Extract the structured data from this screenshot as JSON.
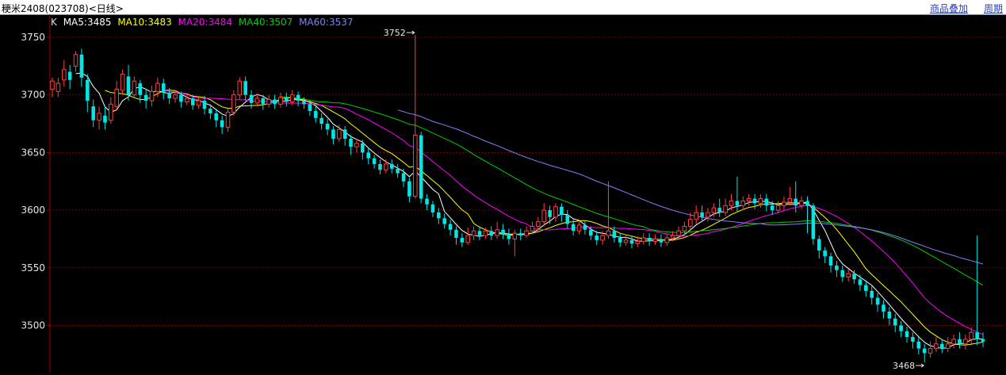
{
  "header": {
    "title": "粳米2408(023708)<日线>",
    "overlay_link": "商品叠加",
    "period_link": "周期"
  },
  "indicator": {
    "label": "K",
    "ma5": "MA5:3485",
    "ma10": "MA10:3483",
    "ma20": "MA20:3484",
    "ma40": "MA40:3507",
    "ma60": "MA60:3537"
  },
  "colors": {
    "background": "#000000",
    "up": "#ff4040",
    "down": "#00e5e5",
    "ma5": "#ffffff",
    "ma10": "#ffff00",
    "ma20": "#ff00ff",
    "ma40": "#00d000",
    "ma60": "#8080ff",
    "grid": "#800000"
  },
  "chart_data": {
    "type": "candlestick",
    "yticks": [
      3750,
      3700,
      3650,
      3600,
      3550,
      3500
    ],
    "ylim": [
      3463,
      3768
    ],
    "annotations": {
      "high": "3752",
      "low": "3468"
    },
    "candles": [
      [
        3705,
        3712,
        3698,
        3715
      ],
      [
        3703,
        3710,
        3698,
        3715
      ],
      [
        3713,
        3722,
        3707,
        3730
      ],
      [
        3720,
        3713,
        3705,
        3726
      ],
      [
        3725,
        3735,
        3720,
        3738
      ],
      [
        3735,
        3715,
        3707,
        3740
      ],
      [
        3713,
        3695,
        3685,
        3718
      ],
      [
        3690,
        3678,
        3672,
        3696
      ],
      [
        3678,
        3684,
        3670,
        3690
      ],
      [
        3682,
        3676,
        3670,
        3690
      ],
      [
        3678,
        3692,
        3675,
        3698
      ],
      [
        3690,
        3705,
        3687,
        3712
      ],
      [
        3704,
        3718,
        3700,
        3722
      ],
      [
        3716,
        3700,
        3695,
        3726
      ],
      [
        3700,
        3712,
        3697,
        3716
      ],
      [
        3710,
        3700,
        3693,
        3713
      ],
      [
        3700,
        3695,
        3688,
        3705
      ],
      [
        3695,
        3703,
        3690,
        3708
      ],
      [
        3703,
        3710,
        3698,
        3715
      ],
      [
        3710,
        3702,
        3696,
        3714
      ],
      [
        3702,
        3697,
        3692,
        3706
      ],
      [
        3697,
        3700,
        3693,
        3704
      ],
      [
        3700,
        3694,
        3689,
        3703
      ],
      [
        3694,
        3697,
        3691,
        3700
      ],
      [
        3697,
        3691,
        3687,
        3700
      ],
      [
        3691,
        3695,
        3688,
        3698
      ],
      [
        3695,
        3688,
        3683,
        3699
      ],
      [
        3688,
        3684,
        3679,
        3692
      ],
      [
        3684,
        3678,
        3672,
        3688
      ],
      [
        3678,
        3672,
        3666,
        3682
      ],
      [
        3672,
        3685,
        3668,
        3689
      ],
      [
        3685,
        3700,
        3682,
        3704
      ],
      [
        3700,
        3712,
        3696,
        3715
      ],
      [
        3712,
        3700,
        3695,
        3716
      ],
      [
        3700,
        3693,
        3688,
        3704
      ],
      [
        3693,
        3697,
        3690,
        3701
      ],
      [
        3697,
        3692,
        3687,
        3700
      ],
      [
        3692,
        3696,
        3689,
        3700
      ],
      [
        3696,
        3692,
        3688,
        3700
      ],
      [
        3692,
        3698,
        3689,
        3702
      ],
      [
        3698,
        3694,
        3690,
        3702
      ],
      [
        3694,
        3700,
        3691,
        3704
      ],
      [
        3700,
        3695,
        3690,
        3703
      ],
      [
        3695,
        3692,
        3688,
        3698
      ],
      [
        3692,
        3686,
        3682,
        3695
      ],
      [
        3686,
        3680,
        3676,
        3690
      ],
      [
        3680,
        3675,
        3670,
        3684
      ],
      [
        3675,
        3670,
        3665,
        3679
      ],
      [
        3670,
        3662,
        3657,
        3673
      ],
      [
        3662,
        3670,
        3659,
        3674
      ],
      [
        3670,
        3662,
        3656,
        3673
      ],
      [
        3662,
        3655,
        3648,
        3665
      ],
      [
        3655,
        3658,
        3650,
        3662
      ],
      [
        3658,
        3650,
        3644,
        3661
      ],
      [
        3650,
        3645,
        3640,
        3654
      ],
      [
        3645,
        3640,
        3636,
        3648
      ],
      [
        3640,
        3635,
        3631,
        3644
      ],
      [
        3635,
        3640,
        3632,
        3644
      ],
      [
        3640,
        3636,
        3632,
        3644
      ],
      [
        3636,
        3632,
        3628,
        3640
      ],
      [
        3632,
        3625,
        3620,
        3636
      ],
      [
        3625,
        3612,
        3607,
        3628
      ],
      [
        3612,
        3665,
        3610,
        3752
      ],
      [
        3665,
        3610,
        3606,
        3668
      ],
      [
        3610,
        3605,
        3600,
        3614
      ],
      [
        3605,
        3598,
        3594,
        3608
      ],
      [
        3598,
        3593,
        3588,
        3602
      ],
      [
        3593,
        3588,
        3584,
        3597
      ],
      [
        3588,
        3583,
        3578,
        3592
      ],
      [
        3583,
        3576,
        3570,
        3586
      ],
      [
        3576,
        3572,
        3568,
        3580
      ],
      [
        3572,
        3578,
        3570,
        3585
      ],
      [
        3578,
        3582,
        3574,
        3586
      ],
      [
        3582,
        3578,
        3574,
        3586
      ],
      [
        3578,
        3582,
        3575,
        3585
      ],
      [
        3582,
        3578,
        3574,
        3586
      ],
      [
        3578,
        3583,
        3575,
        3590
      ],
      [
        3583,
        3579,
        3575,
        3588
      ],
      [
        3579,
        3575,
        3570,
        3584
      ],
      [
        3575,
        3580,
        3560,
        3583
      ],
      [
        3580,
        3578,
        3574,
        3584
      ],
      [
        3578,
        3582,
        3576,
        3586
      ],
      [
        3582,
        3586,
        3579,
        3590
      ],
      [
        3586,
        3590,
        3582,
        3594
      ],
      [
        3590,
        3600,
        3586,
        3606
      ],
      [
        3600,
        3594,
        3588,
        3604
      ],
      [
        3594,
        3603,
        3590,
        3606
      ],
      [
        3603,
        3596,
        3590,
        3606
      ],
      [
        3596,
        3588,
        3584,
        3600
      ],
      [
        3588,
        3582,
        3578,
        3592
      ],
      [
        3582,
        3587,
        3579,
        3590
      ],
      [
        3587,
        3583,
        3579,
        3591
      ],
      [
        3583,
        3578,
        3574,
        3586
      ],
      [
        3578,
        3574,
        3570,
        3582
      ],
      [
        3574,
        3578,
        3570,
        3582
      ],
      [
        3578,
        3582,
        3575,
        3625
      ],
      [
        3582,
        3576,
        3572,
        3586
      ],
      [
        3576,
        3572,
        3568,
        3580
      ],
      [
        3572,
        3574,
        3569,
        3578
      ],
      [
        3574,
        3571,
        3567,
        3578
      ],
      [
        3571,
        3573,
        3568,
        3577
      ],
      [
        3573,
        3576,
        3570,
        3580
      ],
      [
        3576,
        3573,
        3569,
        3580
      ],
      [
        3573,
        3575,
        3570,
        3579
      ],
      [
        3575,
        3572,
        3568,
        3579
      ],
      [
        3572,
        3576,
        3569,
        3580
      ],
      [
        3576,
        3578,
        3573,
        3582
      ],
      [
        3578,
        3582,
        3575,
        3586
      ],
      [
        3582,
        3586,
        3578,
        3590
      ],
      [
        3586,
        3592,
        3583,
        3598
      ],
      [
        3592,
        3598,
        3588,
        3604
      ],
      [
        3598,
        3594,
        3590,
        3604
      ],
      [
        3594,
        3598,
        3590,
        3602
      ],
      [
        3598,
        3602,
        3594,
        3606
      ],
      [
        3602,
        3598,
        3594,
        3610
      ],
      [
        3598,
        3604,
        3595,
        3610
      ],
      [
        3604,
        3608,
        3600,
        3614
      ],
      [
        3608,
        3604,
        3598,
        3629
      ],
      [
        3604,
        3608,
        3600,
        3612
      ],
      [
        3608,
        3610,
        3604,
        3614
      ],
      [
        3610,
        3606,
        3601,
        3614
      ],
      [
        3606,
        3610,
        3602,
        3614
      ],
      [
        3610,
        3604,
        3599,
        3614
      ],
      [
        3604,
        3600,
        3596,
        3608
      ],
      [
        3600,
        3604,
        3597,
        3608
      ],
      [
        3604,
        3607,
        3600,
        3612
      ],
      [
        3607,
        3610,
        3604,
        3620
      ],
      [
        3610,
        3604,
        3598,
        3625
      ],
      [
        3604,
        3608,
        3601,
        3612
      ],
      [
        3608,
        3604,
        3580,
        3612
      ],
      [
        3604,
        3575,
        3570,
        3606
      ],
      [
        3575,
        3565,
        3558,
        3578
      ],
      [
        3565,
        3560,
        3554,
        3568
      ],
      [
        3560,
        3552,
        3546,
        3563
      ],
      [
        3552,
        3548,
        3542,
        3556
      ],
      [
        3548,
        3542,
        3538,
        3552
      ],
      [
        3542,
        3545,
        3538,
        3549
      ],
      [
        3545,
        3540,
        3536,
        3548
      ],
      [
        3540,
        3535,
        3530,
        3544
      ],
      [
        3535,
        3530,
        3525,
        3539
      ],
      [
        3530,
        3524,
        3518,
        3534
      ],
      [
        3524,
        3518,
        3512,
        3528
      ],
      [
        3518,
        3512,
        3506,
        3522
      ],
      [
        3512,
        3506,
        3500,
        3516
      ],
      [
        3506,
        3500,
        3494,
        3510
      ],
      [
        3500,
        3495,
        3490,
        3504
      ],
      [
        3495,
        3490,
        3485,
        3499
      ],
      [
        3490,
        3486,
        3480,
        3494
      ],
      [
        3486,
        3480,
        3475,
        3490
      ],
      [
        3480,
        3476,
        3468,
        3484
      ],
      [
        3476,
        3480,
        3472,
        3486
      ],
      [
        3480,
        3484,
        3477,
        3490
      ],
      [
        3484,
        3480,
        3476,
        3488
      ],
      [
        3480,
        3484,
        3477,
        3490
      ],
      [
        3484,
        3488,
        3480,
        3492
      ],
      [
        3488,
        3484,
        3480,
        3494
      ],
      [
        3484,
        3488,
        3479,
        3492
      ],
      [
        3488,
        3494,
        3484,
        3498
      ],
      [
        3494,
        3488,
        3483,
        3578
      ],
      [
        3488,
        3486,
        3481,
        3494
      ]
    ]
  }
}
